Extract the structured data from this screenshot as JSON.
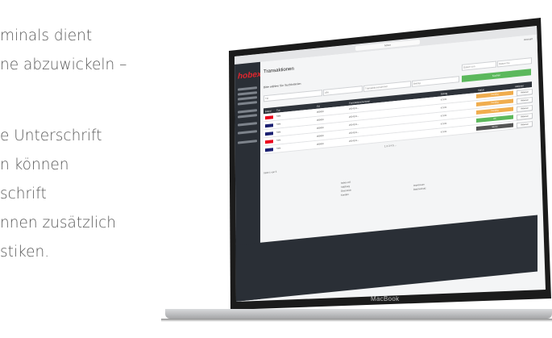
{
  "marketing_text": {
    "lines": [
      "minals dient",
      "ne abzuwickeln –",
      "e Unterschrift",
      "n können",
      "schrift",
      "nnen zusätzlich",
      "stiken."
    ]
  },
  "device": {
    "label": "MacBook"
  },
  "browser": {
    "url": "hobex"
  },
  "app": {
    "logo": "hobex",
    "page_title": "Transaktionen",
    "user_menu": "Account",
    "subtitle": "Bitte wählen Sie Suchkriterien",
    "filters": {
      "field1": "Tid",
      "field2": "Alle",
      "field3": "Transaktionsnummer",
      "field4": "Betrag",
      "field5": "Datum von",
      "field6": "Datum bis"
    },
    "search_button": "Suchen",
    "table": {
      "headers": [
        "Brand",
        "Typ",
        "Tid",
        "Transaktionsnummer",
        "Betrag",
        "Status",
        "Aktionen"
      ],
      "rows": [
        {
          "brand_color": "#eb001b",
          "typ": "Sale",
          "tid": "000000",
          "tr": "2014121...",
          "status": "Pending",
          "status_color": "#f0ad4e",
          "amount": "€ 0,01"
        },
        {
          "brand_color": "#1a1f71",
          "typ": "Sale",
          "tid": "000000",
          "tr": "2014121...",
          "status": "Pending",
          "status_color": "#f0ad4e",
          "amount": "€ 0,01"
        },
        {
          "brand_color": "#1a1f71",
          "typ": "Sale",
          "tid": "000000",
          "tr": "2014121...",
          "status": "Pending",
          "status_color": "#f0ad4e",
          "amount": "€ 0,01"
        },
        {
          "brand_color": "#eb001b",
          "typ": "Sale",
          "tid": "000000",
          "tr": "2014121...",
          "status": "OK",
          "status_color": "#5cb85c",
          "amount": "€ 0,01"
        },
        {
          "brand_color": "#1a1f71",
          "typ": "Sale",
          "tid": "000000",
          "tr": "2014121...",
          "status": "Storno",
          "status_color": "#555555",
          "amount": "€ 0,01"
        }
      ],
      "action_label": "Aktionen"
    },
    "pagination": "1 2 3 4 5 ... ",
    "results_info": "Seite 1 von 5",
    "footer": {
      "left_lines": [
        "hobex AG",
        "Salzburg",
        "Österreich",
        "Kontakt"
      ],
      "right_lines": [
        "Impressum",
        "Datenschutz"
      ]
    }
  }
}
